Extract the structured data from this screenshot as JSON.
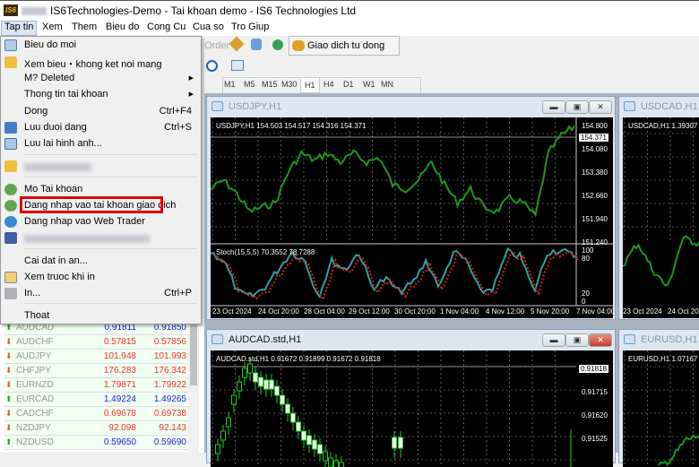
{
  "window": {
    "title": "IS6Technologies-Demo - Tai khoan demo - IS6 Technologies Ltd",
    "logo": "IS6"
  },
  "menubar": [
    "Tap tin",
    "Xem",
    "Them",
    "Bieu do",
    "Cong Cu",
    "Cua so",
    "Tro Giup"
  ],
  "toolbar": {
    "order_label": "Order",
    "auto_trade_label": "Giao dich tu dong",
    "timeframes": [
      "M1",
      "M5",
      "M15",
      "M30",
      "H1",
      "H4",
      "D1",
      "W1",
      "MN"
    ],
    "active_timeframe": "H1"
  },
  "file_menu": {
    "items": [
      {
        "label": "Bieu do moi",
        "icon": "new-chart-icon"
      },
      {
        "label": "Xem bieu・khong ket noi mang",
        "icon": "open-folder-icon"
      },
      {
        "label": "M? Deleted",
        "submenu": true
      },
      {
        "label": "Thong tin tai khoan",
        "submenu": true
      },
      {
        "label": "Dong",
        "shortcut": "Ctrl+F4"
      },
      {
        "label": "Luu duoi dang",
        "shortcut": "Ctrl+S",
        "icon": "save-icon"
      },
      {
        "label": "Luu lai hinh anh...",
        "icon": "save-picture-icon"
      },
      {
        "label": "Mo Tai khoan",
        "icon": "open-account-icon"
      },
      {
        "label": "Dang nhap vao tai khoan giao dich",
        "icon": "login-icon",
        "highlighted": true
      },
      {
        "label": "Dang nhap vao Web Trader",
        "icon": "web-trader-icon"
      },
      {
        "label": "Cai dat in an..."
      },
      {
        "label": "Xem truoc khi in",
        "icon": "print-preview-icon"
      },
      {
        "label": "In...",
        "shortcut": "Ctrl+P",
        "icon": "print-icon"
      },
      {
        "label": "Thoat"
      }
    ],
    "highlight_color": "#e00000"
  },
  "market_watch": {
    "rows": [
      {
        "symbol": "AUDCAD",
        "bid": "0.91811",
        "ask": "0.91850",
        "dir": "up"
      },
      {
        "symbol": "AUDCHF",
        "bid": "0.57815",
        "ask": "0.57856",
        "dir": "down"
      },
      {
        "symbol": "AUDJPY",
        "bid": "101.948",
        "ask": "101.993",
        "dir": "down"
      },
      {
        "symbol": "CHFJPY",
        "bid": "176.283",
        "ask": "176.342",
        "dir": "down"
      },
      {
        "symbol": "EURNZD",
        "bid": "1.79871",
        "ask": "1.79922",
        "dir": "down"
      },
      {
        "symbol": "EURCAD",
        "bid": "1.49224",
        "ask": "1.49265",
        "dir": "up"
      },
      {
        "symbol": "CADCHF",
        "bid": "0.69678",
        "ask": "0.69738",
        "dir": "down"
      },
      {
        "symbol": "NZDJPY",
        "bid": "92.098",
        "ask": "92.143",
        "dir": "down"
      },
      {
        "symbol": "NZDUSD",
        "bid": "0.59650",
        "ask": "0.59690",
        "dir": "up"
      }
    ],
    "up_color": "#2020e0",
    "down_color": "#f03030"
  },
  "charts": {
    "usdjpy": {
      "title": "USDJPY,H1",
      "info": "USDJPY,H1  154.503 154.517 154.316 154.371",
      "prices": [
        "154.800",
        "154.080",
        "153.380",
        "152.660",
        "151.940",
        "151.240"
      ],
      "current": "154.371",
      "indicator": "Stoch(15,5,5) 70.3552 78.7288",
      "ind_levels": [
        "100",
        "80",
        "20",
        "0"
      ],
      "dates": [
        "23 Oct 2024",
        "24 Oct 20:00",
        "28 Oct 04:00",
        "29 Oct 12:00",
        "30 Oct 20:00",
        "1 Nov 04:00",
        "4 Nov 12:00",
        "5 Nov 20:00",
        "7 Nov 04:00"
      ]
    },
    "audcad": {
      "title": "AUDCAD.std,H1",
      "info": "AUDCAD.std,H1  0.91672 0.91899 0.91672 0.91818",
      "prices": [
        "0.91715",
        "0.91620",
        "0.91525"
      ],
      "current": "0.91818"
    },
    "usdcad": {
      "title": "USDCAD,H1",
      "info": "USDCAD,H1  1.39307",
      "dates": [
        "23 Oct 2024",
        "24 Oct 20"
      ]
    },
    "eurusd": {
      "title": "EURUSD,H1",
      "info": "EURUSD,H1  1.07167"
    }
  }
}
